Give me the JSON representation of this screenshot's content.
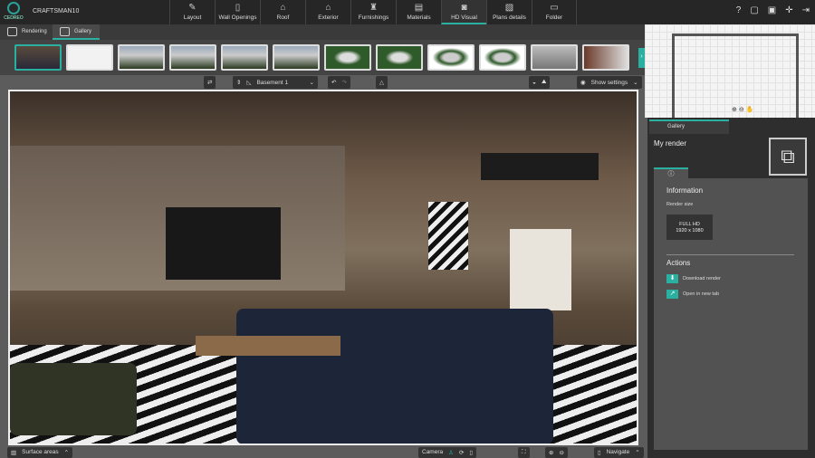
{
  "app": {
    "logo": "CEDREO",
    "project": "CRAFTSMAN10"
  },
  "nav": [
    {
      "label": "Layout",
      "icon": "pencil-icon"
    },
    {
      "label": "Wall Openings",
      "icon": "door-icon"
    },
    {
      "label": "Roof",
      "icon": "roof-icon"
    },
    {
      "label": "Exterior",
      "icon": "house-icon"
    },
    {
      "label": "Furnishings",
      "icon": "lamp-icon"
    },
    {
      "label": "Materials",
      "icon": "paint-roller-icon"
    },
    {
      "label": "HD Visual",
      "icon": "camera-icon",
      "active": true
    },
    {
      "label": "Plans details",
      "icon": "plans-icon"
    },
    {
      "label": "Folder",
      "icon": "folder-icon"
    }
  ],
  "tabs": {
    "rendering": "Rendering",
    "gallery": "Gallery"
  },
  "toolbar": {
    "level": "Basement 1",
    "show_settings": "Show settings"
  },
  "panel": {
    "tab": "Gallery",
    "title": "My render",
    "info_heading": "Information",
    "render_size_label": "Render size",
    "render_size_name": "FULL HD",
    "render_size_value": "1920 x 1080",
    "actions_heading": "Actions",
    "download": "Download render",
    "open_tab": "Open in new tab"
  },
  "bottom": {
    "surface_areas": "Surface areas",
    "camera": "Camera",
    "navigate": "Navigate"
  },
  "colors": {
    "accent": "#2ab0a0"
  }
}
